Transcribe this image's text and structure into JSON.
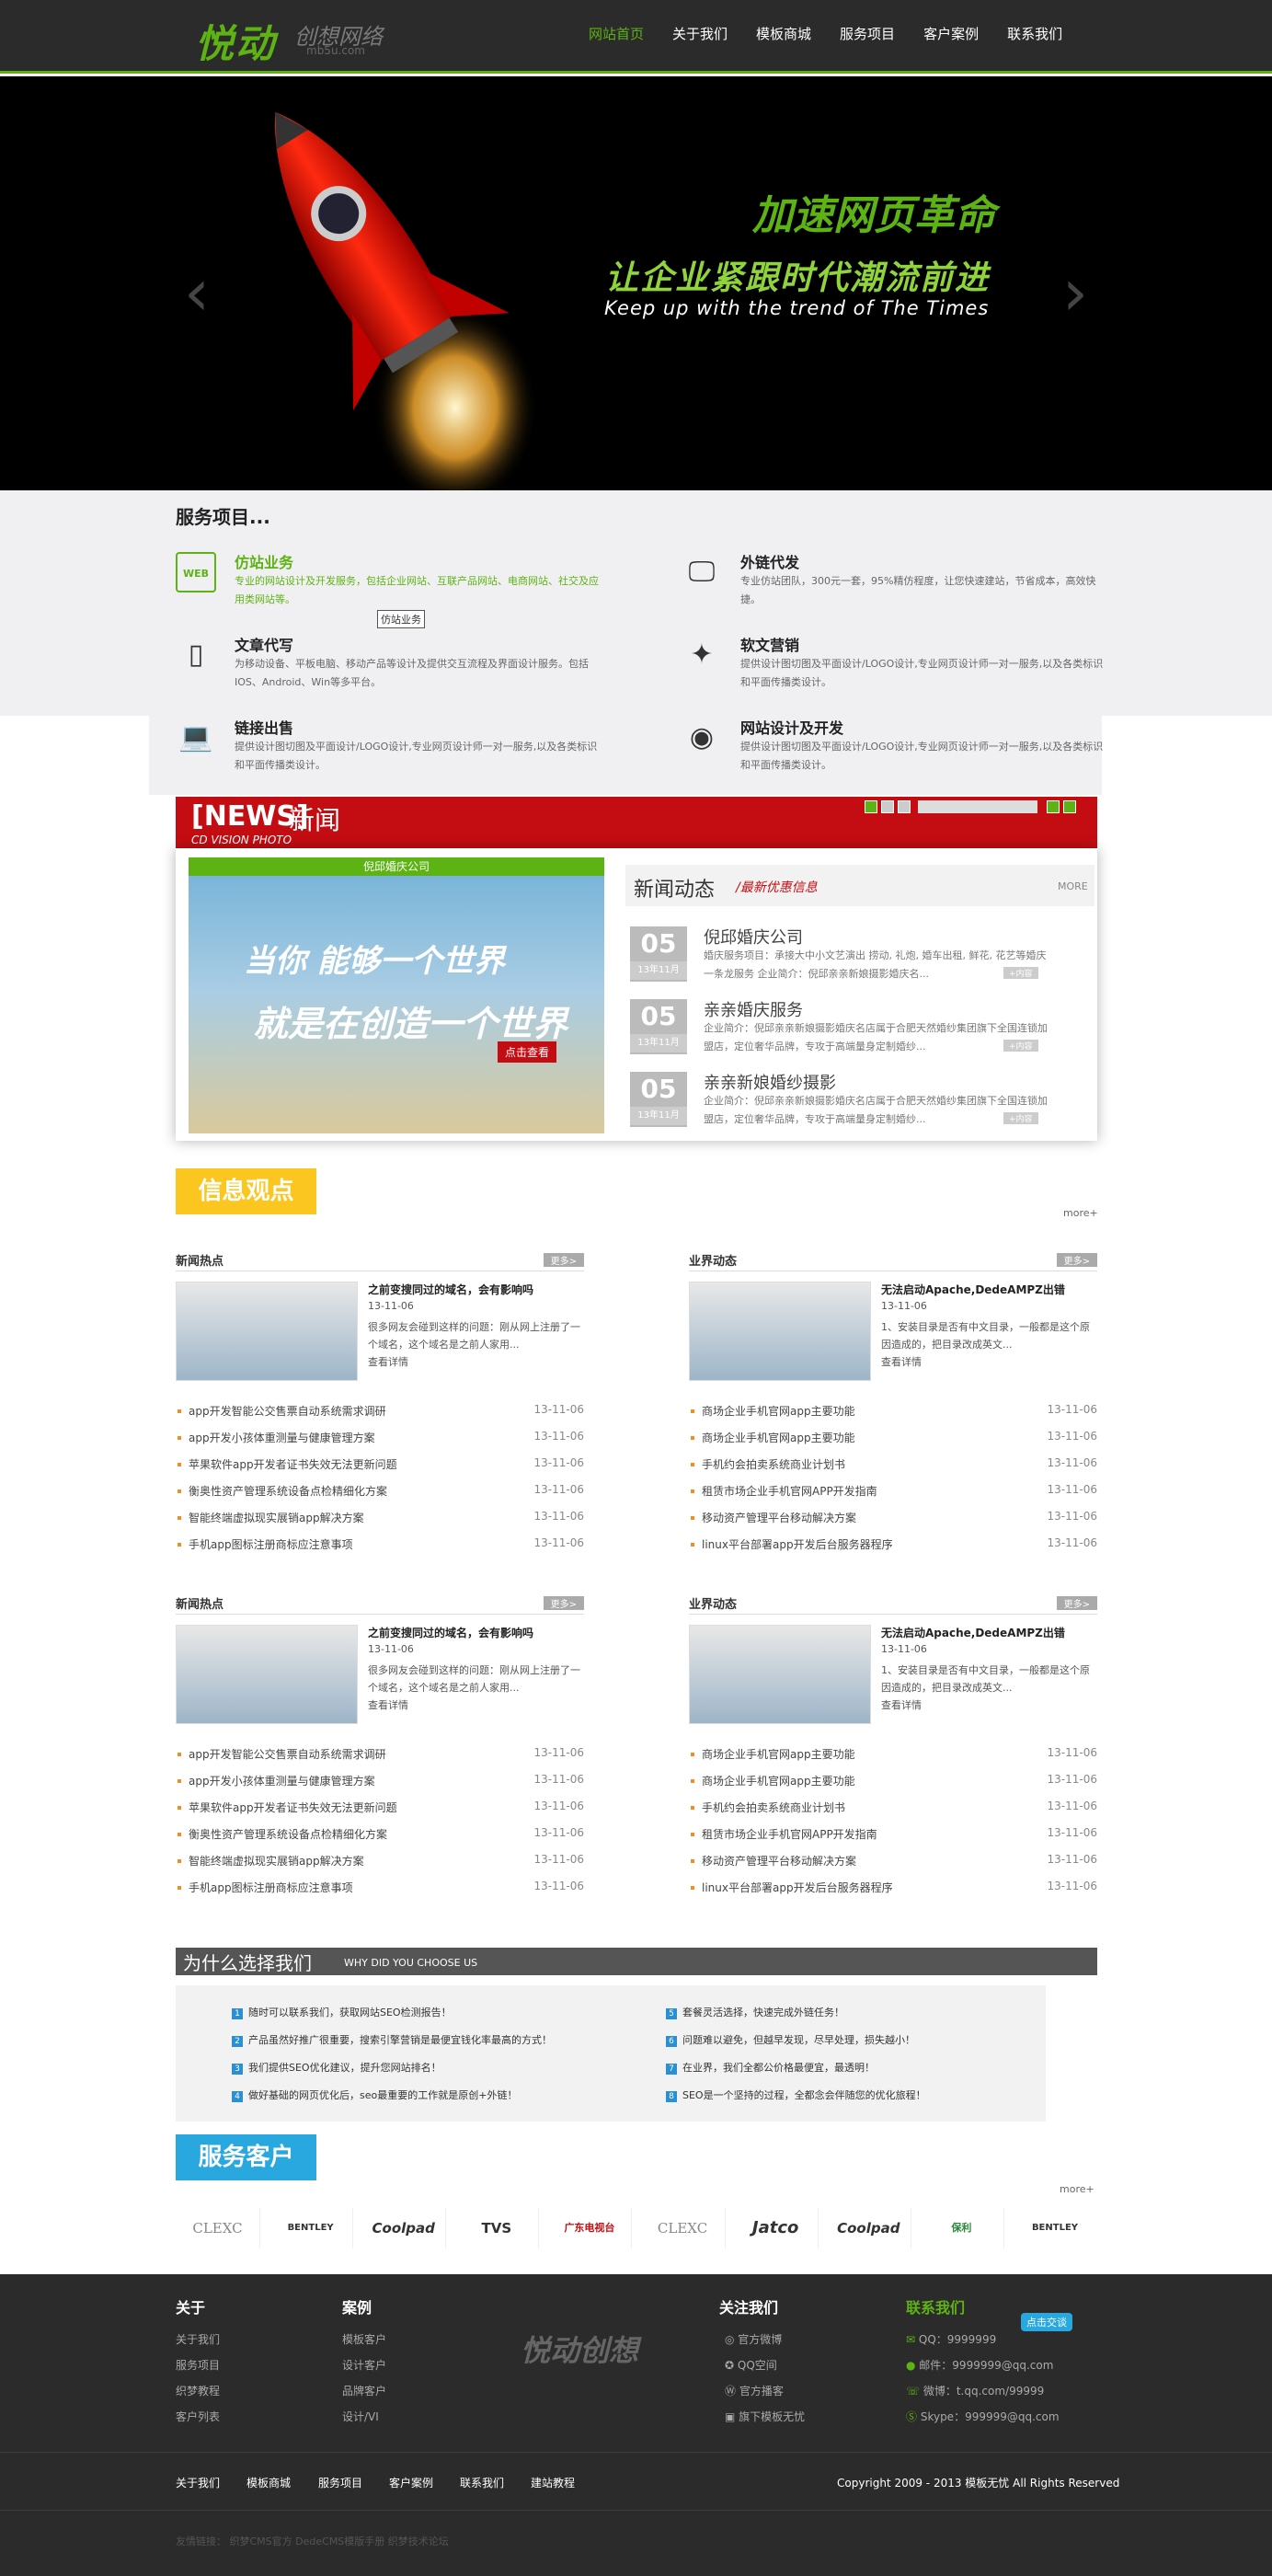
{
  "header": {
    "logo": "悦动",
    "logo_sub": "创想网络",
    "logo_url": "mb5u.com",
    "nav": [
      "网站首页",
      "关于我们",
      "模板商城",
      "服务项目",
      "客户案例",
      "联系我们"
    ]
  },
  "banner": {
    "line1": "加速网页革命",
    "line2": "让企业紧跟时代潮流前进",
    "line3": "Keep up with the trend of The Times",
    "prev": "‹",
    "next": "›"
  },
  "services": {
    "title": "服务项目...",
    "items": [
      {
        "icon": "web-icon",
        "title": "仿站业务",
        "desc": "专业的网站设计及开发服务，包括企业网站、互联产品网站、电商网站、社交及应用类网站等。"
      },
      {
        "icon": "monitor-icon",
        "title": "外链代发",
        "desc": "专业仿站团队，300元一套，95%精仿程度，让您快速建站，节省成本，高效快捷。"
      },
      {
        "icon": "tablet-icon",
        "title": "文章代写",
        "desc": "为移动设备、平板电脑、移动产品等设计及提供交互流程及界面设计服务。包括IOS、Android、Win等多平台。"
      },
      {
        "icon": "magic-wand-icon",
        "title": "软文营销",
        "desc": "提供设计图切图及平面设计/LOGO设计,专业网页设计师一对一服务,以及各类标识和平面传播类设计。"
      },
      {
        "icon": "laptop-icon",
        "title": "链接出售",
        "desc": "提供设计图切图及平面设计/LOGO设计,专业网页设计师一对一服务,以及各类标识和平面传播类设计。"
      },
      {
        "icon": "chrome-icon",
        "title": "网站设计及开发",
        "desc": "提供设计图切图及平面设计/LOGO设计,专业网页设计师一对一服务,以及各类标识和平面传播类设计。"
      }
    ],
    "tooltip": "仿站业务"
  },
  "news": {
    "tag": "[NEWS]",
    "cn": "新闻",
    "sub": "CD VISION PHOTO",
    "slide_caption": "倪邱婚庆公司",
    "slide_line1": "当你 能够一个世界",
    "slide_line2": "就是在创造一个世界",
    "slide_btn": "点击查看",
    "panel_title": "新闻动态",
    "panel_sub": "/最新优惠信息",
    "panel_more": "MORE",
    "items": [
      {
        "day": "05",
        "ym": "13年11月",
        "title": "倪邱婚庆公司",
        "desc": "婚庆服务项目：承接大中小文艺演出 捞动, 礼炮, 婚车出租, 鲜花, 花艺等婚庆一条龙服务  企业简介：倪邱亲亲新娘摄影婚庆名...",
        "btn": "+内容"
      },
      {
        "day": "05",
        "ym": "13年11月",
        "title": "亲亲婚庆服务",
        "desc": "企业简介：倪邱亲亲新娘摄影婚庆名店属于合肥天然婚纱集团旗下全国连锁加盟店，定位奢华品牌，专攻于高端量身定制婚纱...",
        "btn": "+内容"
      },
      {
        "day": "05",
        "ym": "13年11月",
        "title": "亲亲新娘婚纱摄影",
        "desc": "企业简介：倪邱亲亲新娘摄影婚庆名店属于合肥天然婚纱集团旗下全国连锁加盟店，定位奢华品牌，专攻于高端量身定制婚纱...",
        "btn": "+内容"
      }
    ]
  },
  "info": {
    "title": "信息观点",
    "more": "more+",
    "boxes": [
      {
        "head": "新闻热点",
        "more": "更多>",
        "ft": "之前变搜同过的域名，会有影响吗",
        "fd": "13-11-06",
        "fx": "很多网友会碰到这样的问题：刚从网上注册了一个域名，这个域名是之前人家用...",
        "fm": "查看详情",
        "list": [
          [
            "app开发智能公交售票自动系统需求调研",
            "13-11-06"
          ],
          [
            "app开发小孩体重测量与健康管理方案",
            "13-11-06"
          ],
          [
            "苹果软件app开发者证书失效无法更新问题",
            "13-11-06"
          ],
          [
            "衡奥性资产管理系统设备点检精细化方案",
            "13-11-06"
          ],
          [
            "智能终端虚拟现实展销app解决方案",
            "13-11-06"
          ],
          [
            "手机app图标注册商标应注意事项",
            "13-11-06"
          ]
        ]
      },
      {
        "head": "业界动态",
        "more": "更多>",
        "ft": "无法启动Apache,DedeAMPZ出错",
        "fd": "13-11-06",
        "fx": "1、安装目录是否有中文目录，一般都是这个原因造成的，把目录改成英文...",
        "fm": "查看详情",
        "list": [
          [
            "商场企业手机官网app主要功能",
            "13-11-06"
          ],
          [
            "商场企业手机官网app主要功能",
            "13-11-06"
          ],
          [
            "手机约会拍卖系统商业计划书",
            "13-11-06"
          ],
          [
            "租赁市场企业手机官网APP开发指南",
            "13-11-06"
          ],
          [
            "移动资产管理平台移动解决方案",
            "13-11-06"
          ],
          [
            "linux平台部署app开发后台服务器程序",
            "13-11-06"
          ]
        ]
      },
      {
        "head": "新闻热点",
        "more": "更多>",
        "ft": "之前变搜同过的域名，会有影响吗",
        "fd": "13-11-06",
        "fx": "很多网友会碰到这样的问题：刚从网上注册了一个域名，这个域名是之前人家用...",
        "fm": "查看详情",
        "list": [
          [
            "app开发智能公交售票自动系统需求调研",
            "13-11-06"
          ],
          [
            "app开发小孩体重测量与健康管理方案",
            "13-11-06"
          ],
          [
            "苹果软件app开发者证书失效无法更新问题",
            "13-11-06"
          ],
          [
            "衡奥性资产管理系统设备点检精细化方案",
            "13-11-06"
          ],
          [
            "智能终端虚拟现实展销app解决方案",
            "13-11-06"
          ],
          [
            "手机app图标注册商标应注意事项",
            "13-11-06"
          ]
        ]
      },
      {
        "head": "业界动态",
        "more": "更多>",
        "ft": "无法启动Apache,DedeAMPZ出错",
        "fd": "13-11-06",
        "fx": "1、安装目录是否有中文目录，一般都是这个原因造成的，把目录改成英文...",
        "fm": "查看详情",
        "list": [
          [
            "商场企业手机官网app主要功能",
            "13-11-06"
          ],
          [
            "商场企业手机官网app主要功能",
            "13-11-06"
          ],
          [
            "手机约会拍卖系统商业计划书",
            "13-11-06"
          ],
          [
            "租赁市场企业手机官网APP开发指南",
            "13-11-06"
          ],
          [
            "移动资产管理平台移动解决方案",
            "13-11-06"
          ],
          [
            "linux平台部署app开发后台服务器程序",
            "13-11-06"
          ]
        ]
      }
    ]
  },
  "why": {
    "cn": "为什么选择我们",
    "en": "WHY DID YOU CHOOSE US",
    "items": [
      [
        "1",
        "随时可以联系我们，获取网站SEO检测报告！"
      ],
      [
        "2",
        "产品虽然好推广很重要，搜索引擎营销是最便宜钱化率最高的方式！"
      ],
      [
        "3",
        "我们提供SEO优化建议，提升您网站排名！"
      ],
      [
        "4",
        "做好基础的网页优化后，seo最重要的工作就是原创+外链！"
      ],
      [
        "5",
        "套餐灵活选择，快速完成外链任务！"
      ],
      [
        "6",
        "问题难以避免，但越早发现，尽早处理，损失越小！"
      ],
      [
        "7",
        "在业界，我们全都公价格最便宜，最透明！"
      ],
      [
        "8",
        "SEO是一个坚持的过程，全都念会伴随您的优化旅程！"
      ]
    ]
  },
  "clients": {
    "title": "服务客户",
    "more": "more+",
    "logos": [
      "CLEXC",
      "BENTLEY",
      "Coolpad",
      "TVS",
      "广东电视台",
      "CLEXC",
      "Jatco",
      "Coolpad",
      "保利",
      "BENTLEY"
    ]
  },
  "footer": {
    "col1": {
      "h": "关于",
      "items": [
        "关于我们",
        "服务项目",
        "织梦教程",
        "客户列表"
      ]
    },
    "col2": {
      "h": "案例",
      "items": [
        "模板客户",
        "设计客户",
        "品牌客户",
        "设计/VI"
      ]
    },
    "logo": "悦动创想",
    "col3": {
      "h": "关注我们",
      "items": [
        "官方微博",
        "QQ空间",
        "官方播客",
        "旗下模板无忧"
      ]
    },
    "col4": {
      "h": "联系我们",
      "items": [
        "QQ：9999999",
        "邮件：9999999@qq.com",
        "微博：t.qq.com/99999",
        "Skype：999999@qq.com"
      ]
    },
    "qq": "点击交谈",
    "bottom": [
      "关于我们",
      "模板商城",
      "服务项目",
      "客户案例",
      "联系我们",
      "建站教程"
    ],
    "copyright": "Copyright 2009 - 2013 模板无忧 All Rights Reserved",
    "links": "友情链接：  织梦CMS官方  DedeCMS模版手册  织梦技术论坛"
  }
}
